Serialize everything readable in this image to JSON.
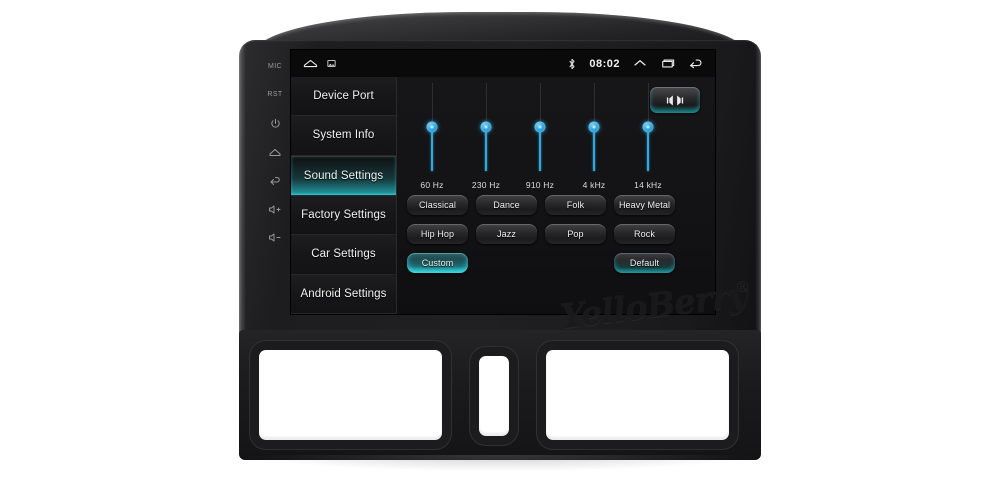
{
  "device": {
    "brand_watermark": "YelloBerry",
    "registered_mark": "®",
    "hardware_keys": [
      {
        "name": "mic-label",
        "label": "MIC"
      },
      {
        "name": "reset-label",
        "label": "RST"
      },
      {
        "name": "power-icon",
        "label": ""
      },
      {
        "name": "home-icon",
        "label": ""
      },
      {
        "name": "back-icon",
        "label": ""
      },
      {
        "name": "volume-up-icon",
        "label": ""
      },
      {
        "name": "volume-down-icon",
        "label": ""
      }
    ]
  },
  "statusbar": {
    "time": "08:02",
    "left_icons": [
      "home-icon",
      "screenshot-icon"
    ],
    "right_icons": [
      "bluetooth-icon",
      "caret-up-icon",
      "recents-icon",
      "back-icon"
    ]
  },
  "sidebar": {
    "items": [
      {
        "label": "Device Port",
        "active": false
      },
      {
        "label": "System Info",
        "active": false
      },
      {
        "label": "Sound Settings",
        "active": true
      },
      {
        "label": "Factory Settings",
        "active": false
      },
      {
        "label": "Car Settings",
        "active": false
      },
      {
        "label": "Android Settings",
        "active": false
      }
    ]
  },
  "panel": {
    "balance_button_label": "",
    "equalizer": {
      "bands": [
        {
          "label": "60 Hz",
          "value": 50
        },
        {
          "label": "230 Hz",
          "value": 50
        },
        {
          "label": "910 Hz",
          "value": 50
        },
        {
          "label": "4 kHz",
          "value": 50
        },
        {
          "label": "14 kHz",
          "value": 50
        }
      ]
    },
    "presets": {
      "rows": [
        [
          {
            "label": "Classical",
            "state": "normal"
          },
          {
            "label": "Dance",
            "state": "normal"
          },
          {
            "label": "Folk",
            "state": "normal"
          },
          {
            "label": "Heavy Metal",
            "state": "normal"
          }
        ],
        [
          {
            "label": "Hip Hop",
            "state": "normal"
          },
          {
            "label": "Jazz",
            "state": "normal"
          },
          {
            "label": "Pop",
            "state": "normal"
          },
          {
            "label": "Rock",
            "state": "normal"
          }
        ],
        [
          {
            "label": "Custom",
            "state": "selected"
          },
          {
            "label": "",
            "state": "spacer"
          },
          {
            "label": "",
            "state": "spacer"
          },
          {
            "label": "Default",
            "state": "underglow"
          }
        ]
      ]
    }
  },
  "colors": {
    "accent_teal": "#29b6c0",
    "slider_blue": "#2fa8e0",
    "screen_bg": "#121214",
    "sidebar_bg": "#141416",
    "statusbar_bg": "#0a0a0a",
    "bezel": "#1d1d1f"
  }
}
